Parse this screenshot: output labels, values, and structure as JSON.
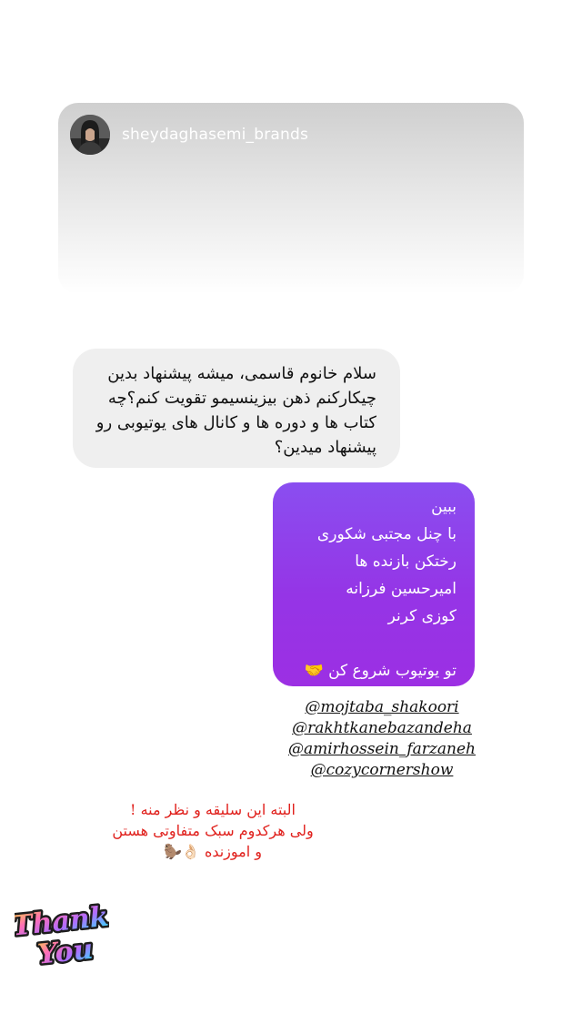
{
  "story": {
    "username": "sheydaghasemi_brands"
  },
  "question": {
    "lines": [
      "سلام خانوم قاسمی، میشه  پیشنهاد بدین",
      "چیکارکنم ذهن بیزینسیمو تقویت کنم؟چه",
      "کتاب ها و دوره ها و کانال های یوتیوبی رو",
      "پیشنهاد میدین؟"
    ]
  },
  "reply": {
    "lines": [
      "ببین",
      "با چنل مجتبی شکوری",
      "رختکن بازنده ها",
      "امیرحسین فرزانه",
      "کوزی کرنر"
    ],
    "closing": "تو یوتیوب شروع کن 🤝"
  },
  "mentions": [
    "@mojtaba_shakoori",
    "@rakhtkanebazandeha",
    "@amirhossein_farzaneh",
    "@cozycornershow"
  ],
  "note": {
    "line1": "البته این سلیقه و نظر منه !",
    "line2": "ولی هرکدوم سبک متفاوتی هستن",
    "line3": "و اموزنده",
    "line3_emoji": "👌🏻🦫"
  },
  "sticker": {
    "word1": "Thank",
    "word2": "You"
  },
  "colors": {
    "reply_gradient_top": "#8a4ef0",
    "reply_gradient_bottom": "#9c2fe3",
    "incoming_bubble": "#efefef",
    "note_text": "#e0201c"
  }
}
